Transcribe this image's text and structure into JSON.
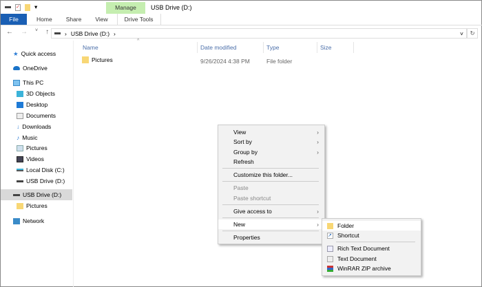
{
  "window": {
    "title": "USB Drive (D:)"
  },
  "ribbon": {
    "context_tab": "Manage",
    "tabs": [
      "File",
      "Home",
      "Share",
      "View",
      "Drive Tools"
    ]
  },
  "address": {
    "crumbs": [
      "USB Drive (D:)"
    ]
  },
  "sidebar": {
    "items": [
      {
        "label": "Quick access",
        "icon": "star-icon"
      },
      {
        "label": "OneDrive",
        "icon": "cloud-icon"
      },
      {
        "label": "This PC",
        "icon": "monitor-icon"
      },
      {
        "label": "3D Objects",
        "icon": "cube-icon"
      },
      {
        "label": "Desktop",
        "icon": "desktop-icon"
      },
      {
        "label": "Documents",
        "icon": "document-icon"
      },
      {
        "label": "Downloads",
        "icon": "download-icon"
      },
      {
        "label": "Music",
        "icon": "music-icon"
      },
      {
        "label": "Pictures",
        "icon": "pictures-icon"
      },
      {
        "label": "Videos",
        "icon": "video-icon"
      },
      {
        "label": "Local Disk (C:)",
        "icon": "disk-icon"
      },
      {
        "label": "USB Drive (D:)",
        "icon": "usb-drive-icon"
      },
      {
        "label": "USB Drive (D:)",
        "icon": "usb-drive-icon",
        "selected": true
      },
      {
        "label": "Pictures",
        "icon": "folder-icon"
      },
      {
        "label": "Network",
        "icon": "network-icon"
      }
    ]
  },
  "columns": [
    "Name",
    "Date modified",
    "Type",
    "Size"
  ],
  "files": [
    {
      "name": "Pictures",
      "date": "9/26/2024 4:38 PM",
      "type": "File folder",
      "size": ""
    }
  ],
  "context_menu": {
    "items": [
      "View",
      "Sort by",
      "Group by",
      "Refresh",
      "Customize this folder...",
      "Paste",
      "Paste shortcut",
      "Give access to",
      "New",
      "Properties"
    ]
  },
  "new_submenu": {
    "items": [
      "Folder",
      "Shortcut",
      "Rich Text Document",
      "Text Document",
      "WinRAR ZIP archive"
    ]
  },
  "colors": {
    "accent": "#1a5fb4",
    "manage": "#c5eeb0",
    "folder": "#f8d775",
    "selection": "#d9d9d9"
  }
}
